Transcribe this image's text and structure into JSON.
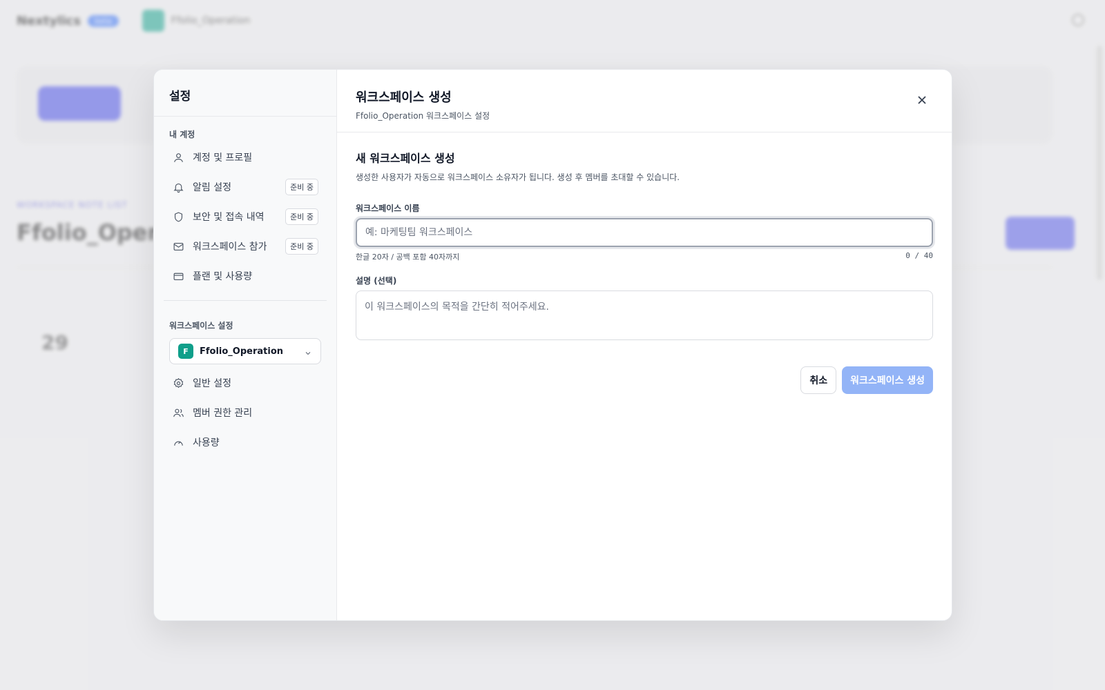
{
  "background": {
    "app_name": "Nextylics",
    "beta_label": "beta",
    "workspace_name": "Ffolio_Operation",
    "page_title": "Ffolio_Operation",
    "section_sub": "WORKSPACE NOTE LIST",
    "date": "29"
  },
  "sidebar": {
    "title": "설정",
    "account_section": "내 계정",
    "account_items": [
      {
        "label": "계정 및 프로필",
        "icon": "user-icon",
        "badge": ""
      },
      {
        "label": "알림 설정",
        "icon": "bell-icon",
        "badge": "준비 중"
      },
      {
        "label": "보안 및 접속 내역",
        "icon": "shield-icon",
        "badge": "준비 중"
      },
      {
        "label": "워크스페이스 참가",
        "icon": "mail-icon",
        "badge": "준비 중"
      },
      {
        "label": "플랜 및 사용량",
        "icon": "credit-card-icon",
        "badge": ""
      }
    ],
    "workspace_section": "워크스페이스 설정",
    "workspace_select": {
      "avatar": "F",
      "name": "Ffolio_Operation"
    },
    "workspace_items": [
      {
        "label": "일반 설정",
        "icon": "gear-icon"
      },
      {
        "label": "멤버 권한 관리",
        "icon": "users-icon"
      },
      {
        "label": "사용량",
        "icon": "gauge-icon"
      }
    ]
  },
  "main": {
    "title": "워크스페이스 생성",
    "subtitle": "Ffolio_Operation 워크스페이스 설정",
    "form": {
      "title": "새 워크스페이스 생성",
      "description": "생성한 사용자가 자동으로 워크스페이스 소유자가 됩니다. 생성 후 멤버를 초대할 수 있습니다.",
      "name_label": "워크스페이스 이름",
      "name_placeholder": "예: 마케팅팀 워크스페이스",
      "name_value": "",
      "name_hint": "한글 20자 / 공백 포함 40자까지",
      "name_counter": "0 / 40",
      "desc_label": "설명 (선택)",
      "desc_placeholder": "이 워크스페이스의 목적을 간단히 적어주세요.",
      "desc_value": "",
      "cancel_label": "취소",
      "submit_label": "워크스페이스 생성"
    }
  },
  "colors": {
    "accent_disabled": "#93b4f7",
    "workspace_avatar": "#0f9f8a"
  }
}
